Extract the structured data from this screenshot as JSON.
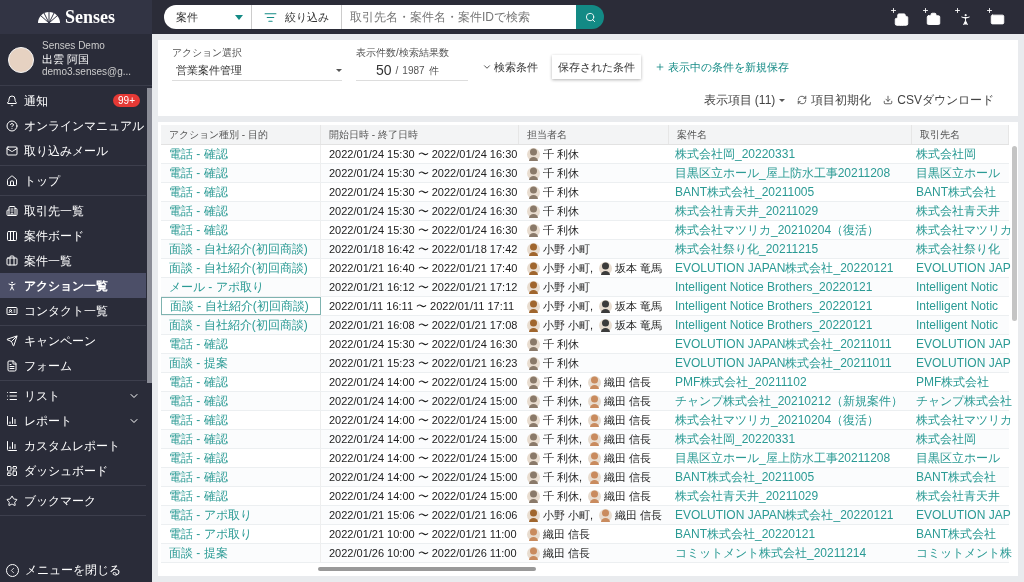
{
  "brand": "Senses",
  "search": {
    "scope": "案件",
    "filter": "絞り込み",
    "placeholder": "取引先名・案件名・案件IDで検索"
  },
  "user": {
    "org": "Senses Demo",
    "name": "出雲 阿国",
    "email": "demo3.senses@g..."
  },
  "sidebar": {
    "groups": [
      [
        {
          "label": "通知",
          "badge": "99+",
          "selected": false
        },
        {
          "label": "オンラインマニュアル",
          "selected": false
        },
        {
          "label": "取り込みメール",
          "selected": false
        }
      ],
      [
        {
          "label": "トップ",
          "selected": false
        }
      ],
      [
        {
          "label": "取引先一覧",
          "selected": false
        },
        {
          "label": "案件ボード",
          "selected": false
        },
        {
          "label": "案件一覧",
          "selected": false
        },
        {
          "label": "アクション一覧",
          "selected": true
        },
        {
          "label": "コンタクト一覧",
          "selected": false
        }
      ],
      [
        {
          "label": "キャンペーン",
          "selected": false
        },
        {
          "label": "フォーム",
          "selected": false
        }
      ],
      [
        {
          "label": "リスト",
          "expandable": true,
          "selected": false
        },
        {
          "label": "レポート",
          "expandable": true,
          "selected": false
        },
        {
          "label": "カスタムレポート",
          "selected": false
        },
        {
          "label": "ダッシュボード",
          "selected": false
        }
      ],
      [
        {
          "label": "ブックマーク",
          "selected": false
        }
      ]
    ],
    "close": "メニューを閉じる"
  },
  "filters": {
    "action_label": "アクション選択",
    "action_value": "営業案件管理",
    "count_label": "表示件数/検索結果数",
    "count": "50",
    "separator": "/",
    "total": "1987",
    "unit": "件",
    "conditions": "検索条件",
    "saved": "保存された条件",
    "save_new": "表示中の条件を新規保存",
    "columns": "表示項目 (11)",
    "reset": "項目初期化",
    "csv": "CSVダウンロード"
  },
  "table": {
    "columns": [
      "アクション種別 - 目的",
      "開始日時 - 終了日時",
      "担当者名",
      "案件名",
      "取引先名"
    ],
    "rows": [
      {
        "action": "電話 - 確認",
        "time": "2022/01/24 15:30 〜 2022/01/24 16:30",
        "assignees": [
          {
            "name": "千 利休",
            "color": "#8a7a6a"
          }
        ],
        "deal": "株式会社岡_20220331",
        "client": "株式会社岡",
        "selected": false
      },
      {
        "action": "電話 - 確認",
        "time": "2022/01/24 15:30 〜 2022/01/24 16:30",
        "assignees": [
          {
            "name": "千 利休",
            "color": "#8a7a6a"
          }
        ],
        "deal": "目黒区立ホール_屋上防水工事20211208",
        "client": "目黒区立ホール",
        "selected": false
      },
      {
        "action": "電話 - 確認",
        "time": "2022/01/24 15:30 〜 2022/01/24 16:30",
        "assignees": [
          {
            "name": "千 利休",
            "color": "#8a7a6a"
          }
        ],
        "deal": "BANT株式会社_20211005",
        "client": "BANT株式会社",
        "selected": false
      },
      {
        "action": "電話 - 確認",
        "time": "2022/01/24 15:30 〜 2022/01/24 16:30",
        "assignees": [
          {
            "name": "千 利休",
            "color": "#8a7a6a"
          }
        ],
        "deal": "株式会社青天井_20211029",
        "client": "株式会社青天井",
        "selected": false
      },
      {
        "action": "電話 - 確認",
        "time": "2022/01/24 15:30 〜 2022/01/24 16:30",
        "assignees": [
          {
            "name": "千 利休",
            "color": "#8a7a6a"
          }
        ],
        "deal": "株式会社マツリカ_20210204（復活）",
        "client": "株式会社マツリカ",
        "selected": false
      },
      {
        "action": "面談 - 自社紹介(初回商談)",
        "time": "2022/01/18 16:42 〜 2022/01/18 17:42",
        "assignees": [
          {
            "name": "小野 小町",
            "color": "#a0662e"
          }
        ],
        "deal": "株式会社祭り化_20211215",
        "client": "株式会社祭り化",
        "selected": false
      },
      {
        "action": "面談 - 自社紹介(初回商談)",
        "time": "2022/01/21 16:40 〜 2022/01/21 17:40",
        "assignees": [
          {
            "name": "小野 小町,",
            "color": "#a0662e"
          },
          {
            "name": "坂本 竜馬",
            "color": "#3b3b3b"
          }
        ],
        "deal": "EVOLUTION JAPAN株式会社_20220121",
        "client": "EVOLUTION JAP",
        "selected": false
      },
      {
        "action": "メール - アポ取り",
        "time": "2022/01/21 16:12 〜 2022/01/21 17:12",
        "assignees": [
          {
            "name": "小野 小町",
            "color": "#a0662e"
          }
        ],
        "deal": "Intelligent Notice Brothers_20220121",
        "client": "Intelligent Notic",
        "selected": false
      },
      {
        "action": "面談 - 自社紹介(初回商談)",
        "time": "2022/01/11 16:11 〜 2022/01/11 17:11",
        "assignees": [
          {
            "name": "小野 小町,",
            "color": "#a0662e"
          },
          {
            "name": "坂本 竜馬",
            "color": "#3b3b3b"
          }
        ],
        "deal": "Intelligent Notice Brothers_20220121",
        "client": "Intelligent Notic",
        "selected": true
      },
      {
        "action": "面談 - 自社紹介(初回商談)",
        "time": "2022/01/21 16:08 〜 2022/01/21 17:08",
        "assignees": [
          {
            "name": "小野 小町,",
            "color": "#a0662e"
          },
          {
            "name": "坂本 竜馬",
            "color": "#3b3b3b"
          }
        ],
        "deal": "Intelligent Notice Brothers_20220121",
        "client": "Intelligent Notic",
        "selected": false
      },
      {
        "action": "電話 - 確認",
        "time": "2022/01/24 15:30 〜 2022/01/24 16:30",
        "assignees": [
          {
            "name": "千 利休",
            "color": "#8a7a6a"
          }
        ],
        "deal": "EVOLUTION JAPAN株式会社_20211011",
        "client": "EVOLUTION JAP",
        "selected": false
      },
      {
        "action": "面談 - 提案",
        "time": "2022/01/21 15:23 〜 2022/01/21 16:23",
        "assignees": [
          {
            "name": "千 利休",
            "color": "#8a7a6a"
          }
        ],
        "deal": "EVOLUTION JAPAN株式会社_20211011",
        "client": "EVOLUTION JAP",
        "selected": false
      },
      {
        "action": "電話 - 確認",
        "time": "2022/01/24 14:00 〜 2022/01/24 15:00",
        "assignees": [
          {
            "name": "千 利休,",
            "color": "#8a7a6a"
          },
          {
            "name": "織田 信長",
            "color": "#c98b5e"
          }
        ],
        "deal": "PMF株式会社_20211102",
        "client": "PMF株式会社",
        "selected": false
      },
      {
        "action": "電話 - 確認",
        "time": "2022/01/24 14:00 〜 2022/01/24 15:00",
        "assignees": [
          {
            "name": "千 利休,",
            "color": "#8a7a6a"
          },
          {
            "name": "織田 信長",
            "color": "#c98b5e"
          }
        ],
        "deal": "チャンプ株式会社_20210212（新規案件）",
        "client": "チャンプ株式会社",
        "selected": false
      },
      {
        "action": "電話 - 確認",
        "time": "2022/01/24 14:00 〜 2022/01/24 15:00",
        "assignees": [
          {
            "name": "千 利休,",
            "color": "#8a7a6a"
          },
          {
            "name": "織田 信長",
            "color": "#c98b5e"
          }
        ],
        "deal": "株式会社マツリカ_20210204（復活）",
        "client": "株式会社マツリカ",
        "selected": false
      },
      {
        "action": "電話 - 確認",
        "time": "2022/01/24 14:00 〜 2022/01/24 15:00",
        "assignees": [
          {
            "name": "千 利休,",
            "color": "#8a7a6a"
          },
          {
            "name": "織田 信長",
            "color": "#c98b5e"
          }
        ],
        "deal": "株式会社岡_20220331",
        "client": "株式会社岡",
        "selected": false
      },
      {
        "action": "電話 - 確認",
        "time": "2022/01/24 14:00 〜 2022/01/24 15:00",
        "assignees": [
          {
            "name": "千 利休,",
            "color": "#8a7a6a"
          },
          {
            "name": "織田 信長",
            "color": "#c98b5e"
          }
        ],
        "deal": "目黒区立ホール_屋上防水工事20211208",
        "client": "目黒区立ホール",
        "selected": false
      },
      {
        "action": "電話 - 確認",
        "time": "2022/01/24 14:00 〜 2022/01/24 15:00",
        "assignees": [
          {
            "name": "千 利休,",
            "color": "#8a7a6a"
          },
          {
            "name": "織田 信長",
            "color": "#c98b5e"
          }
        ],
        "deal": "BANT株式会社_20211005",
        "client": "BANT株式会社",
        "selected": false
      },
      {
        "action": "電話 - 確認",
        "time": "2022/01/24 14:00 〜 2022/01/24 15:00",
        "assignees": [
          {
            "name": "千 利休,",
            "color": "#8a7a6a"
          },
          {
            "name": "織田 信長",
            "color": "#c98b5e"
          }
        ],
        "deal": "株式会社青天井_20211029",
        "client": "株式会社青天井",
        "selected": false
      },
      {
        "action": "電話 - アポ取り",
        "time": "2022/01/21 15:06 〜 2022/01/21 16:06",
        "assignees": [
          {
            "name": "小野 小町,",
            "color": "#a0662e"
          },
          {
            "name": "織田 信長",
            "color": "#c98b5e"
          }
        ],
        "deal": "EVOLUTION JAPAN株式会社_20220121",
        "client": "EVOLUTION JAP",
        "selected": false
      },
      {
        "action": "電話 - アポ取り",
        "time": "2022/01/21 10:00 〜 2022/01/21 11:00",
        "assignees": [
          {
            "name": "織田 信長",
            "color": "#c98b5e"
          }
        ],
        "deal": "BANT株式会社_20220121",
        "client": "BANT株式会社",
        "selected": false
      },
      {
        "action": "面談 - 提案",
        "time": "2022/01/26 10:00 〜 2022/01/26 11:00",
        "assignees": [
          {
            "name": "織田 信長",
            "color": "#c98b5e"
          }
        ],
        "deal": "コミットメント株式会社_20211214",
        "client": "コミットメント株",
        "selected": false
      }
    ]
  }
}
